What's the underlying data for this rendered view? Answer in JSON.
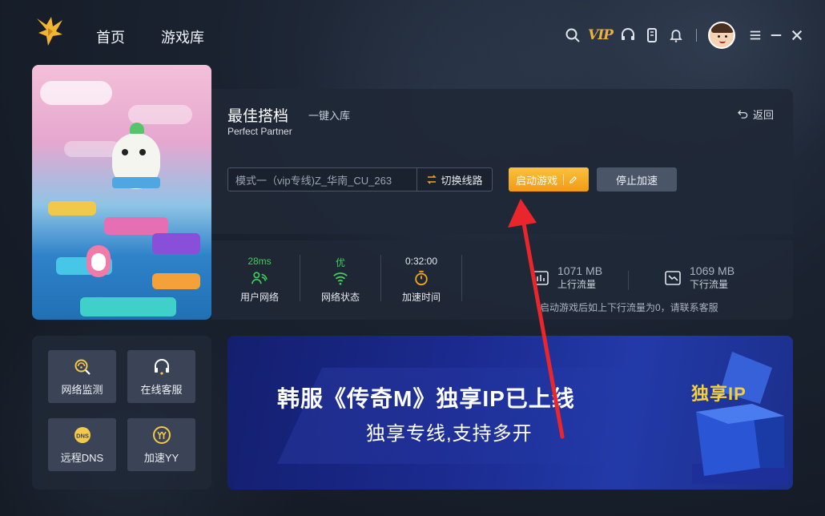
{
  "nav": {
    "home": "首页",
    "library": "游戏库"
  },
  "toolbar": {
    "vip": "VIP",
    "icons": [
      "search-icon",
      "vip-icon",
      "headset-icon",
      "phone-icon",
      "bell-icon",
      "menu-icon",
      "minimize-icon",
      "close-icon"
    ]
  },
  "game": {
    "title": "最佳搭档",
    "add_to_library": "一键入库",
    "subtitle": "Perfect Partner",
    "back": "返回",
    "route": "模式一（vip专线)Z_华南_CU_263",
    "switch_route": "切换线路",
    "start": "启动游戏",
    "stop": "停止加速"
  },
  "stats": {
    "latency_value": "28ms",
    "latency_label": "用户网络",
    "network_value": "优",
    "network_label": "网络状态",
    "time_value": "0:32:00",
    "time_label": "加速时间",
    "upload_value": "1071 MB",
    "upload_label": "上行流量",
    "download_value": "1069 MB",
    "download_label": "下行流量",
    "note": "启动游戏后如上下行流量为0，请联系客服",
    "accent_green": "#3ecf5a",
    "accent_orange": "#f2a51e"
  },
  "tools": [
    {
      "label": "网络监测",
      "icon": "network-monitor-icon"
    },
    {
      "label": "在线客服",
      "icon": "headset-icon"
    },
    {
      "label": "远程DNS",
      "icon": "dns-icon"
    },
    {
      "label": "加速YY",
      "icon": "yy-icon"
    }
  ],
  "banner": {
    "title": "韩服《传奇M》独享IP已上线",
    "subtitle": "独享专线,支持多开",
    "tag": "独享IP"
  }
}
